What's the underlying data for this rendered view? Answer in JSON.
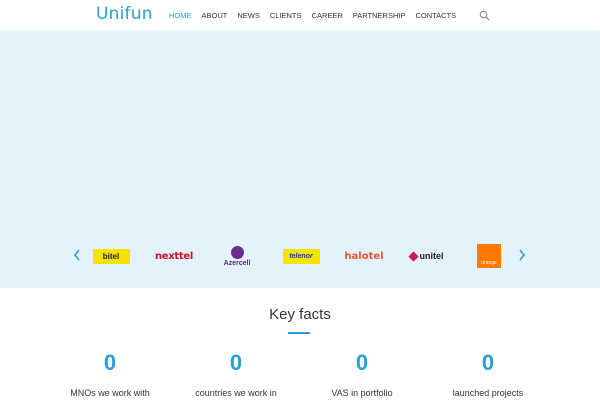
{
  "header": {
    "logo": "Unifun",
    "nav": [
      {
        "label": "HOME",
        "active": true
      },
      {
        "label": "ABOUT",
        "active": false
      },
      {
        "label": "NEWS",
        "active": false
      },
      {
        "label": "CLIENTS",
        "active": false
      },
      {
        "label": "CAREER",
        "active": false
      },
      {
        "label": "PARTNERSHIP",
        "active": false
      },
      {
        "label": "CONTACTS",
        "active": false
      }
    ],
    "search_icon": "search-icon"
  },
  "carousel": {
    "brands": {
      "bitel": "bitel",
      "nexttel": "nexttel",
      "azercell": "Azercell",
      "telenor": "telenor",
      "halotel": "halotel",
      "unitel": "unitel",
      "orange": "orange"
    },
    "prev_icon": "chevron-left-icon",
    "next_icon": "chevron-right-icon"
  },
  "key_facts": {
    "title": "Key facts",
    "items": [
      {
        "value": "0",
        "label": "MNOs we work with"
      },
      {
        "value": "0",
        "label": "countries we work in"
      },
      {
        "value": "0",
        "label": "VAS in portfolio"
      },
      {
        "value": "0",
        "label": "launched projects"
      }
    ]
  },
  "colors": {
    "accent": "#2a9fd6",
    "hero_bg": "#e4f2fa"
  }
}
